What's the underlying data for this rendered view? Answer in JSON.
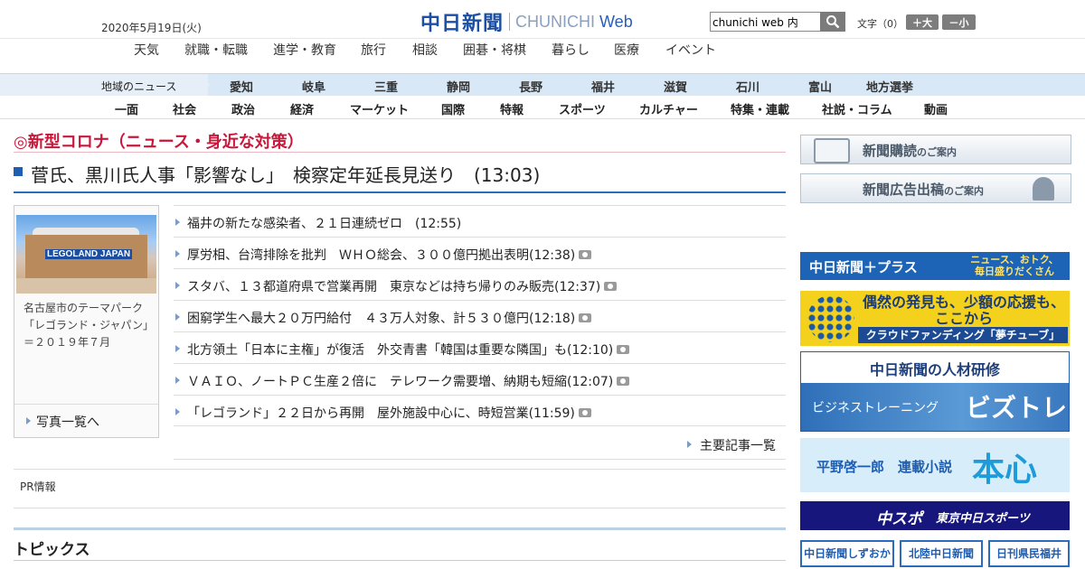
{
  "header": {
    "date": "2020年5月19日(火)",
    "logo_jp": "中日新聞",
    "logo_en": "CHUNICHI",
    "logo_web": "Web",
    "search_value": "chunichi web 内",
    "fontsize_label": "文字（0）",
    "font_bigger": "＋大",
    "font_smaller": "－小"
  },
  "service_nav": [
    "天気",
    "就職・転職",
    "進学・教育",
    "旅行",
    "相談",
    "囲碁・将棋",
    "暮らし",
    "医療",
    "イベント"
  ],
  "region_nav": {
    "label": "地域のニュース",
    "items": [
      "愛知",
      "岐阜",
      "三重",
      "静岡",
      "長野",
      "福井",
      "滋賀",
      "石川",
      "富山",
      "地方選挙"
    ]
  },
  "category_nav": [
    "一面",
    "社会",
    "政治",
    "経済",
    "マーケット",
    "国際",
    "特報",
    "スポーツ",
    "カルチャー",
    "特集・連載",
    "社説・コラム",
    "動画"
  ],
  "main": {
    "section_title": "◎新型コロナ（ニュース・身近な対策）",
    "headline": "菅氏、黒川氏人事「影響なし」　検察定年延長見送り　(13:03)",
    "photo": {
      "sign_text": "LEGOLAND JAPAN",
      "caption": "名古屋市のテーマパーク「レゴランド・ジャパン」＝２０１９年７月",
      "list_link": "写真一覧へ"
    },
    "news": [
      {
        "title": "福井の新たな感染者、２１日連続ゼロ　",
        "time": "(12:55)",
        "photo": false
      },
      {
        "title": "厚労相、台湾排除を批判　ＷＨＯ総会、３００億円拠出表明",
        "time": "(12:38)",
        "photo": true
      },
      {
        "title": "スタバ、１３都道府県で営業再開　東京などは持ち帰りのみ販売",
        "time": "(12:37)",
        "photo": true
      },
      {
        "title": "困窮学生へ最大２０万円給付　４３万人対象、計５３０億円",
        "time": "(12:18)",
        "photo": true
      },
      {
        "title": "北方領土「日本に主権」が復活　外交青書「韓国は重要な隣国」も",
        "time": "(12:10)",
        "photo": true
      },
      {
        "title": "ＶＡＩＯ、ノートＰＣ生産２倍に　テレワーク需要増、納期も短縮",
        "time": "(12:07)",
        "photo": true
      },
      {
        "title": "「レゴランド」２２日から再開　屋外施設中心に、時短営業",
        "time": "(11:59)",
        "photo": true
      }
    ],
    "more_link": "主要記事一覧",
    "pr_label": "PR情報",
    "topics_title": "トピックス"
  },
  "sidebar": {
    "subscribe_main": "新聞購読",
    "subscribe_sub": "のご案内",
    "ad_main": "新聞広告出稿",
    "ad_sub": "のご案内",
    "plus_left": "中日新聞＋プラス",
    "plus_right": "ニュース、おトク、毎日盛りだくさん",
    "crowd_line1": "偶然の発見も、少額の応援も、ここから",
    "crowd_line2": "クラウドファンディング「夢チューブ」",
    "jinzai_title": "中日新聞の人材研修",
    "jinzai_sub": "ビジネストレーニング",
    "jinzai_brand": "ビズトレ",
    "novel_author": "平野啓一郎　連載小説",
    "novel_title": "本心",
    "chuspo": "中スポ",
    "chuspo_sub": "東京中日スポーツ",
    "sub_links": [
      "中日新聞しずおか",
      "北陸中日新聞",
      "日刊県民福井"
    ]
  },
  "colors": {
    "brand_blue": "#1e5db0",
    "section_red": "#c8173a",
    "crowd_yellow": "#f3d11c",
    "chuspo_navy": "#16167c"
  }
}
